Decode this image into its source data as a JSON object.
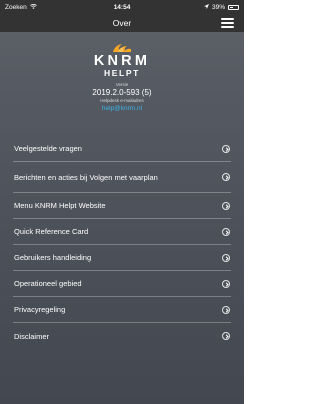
{
  "status_bar": {
    "carrier": "Zoeken",
    "time": "14:54",
    "battery": "39%"
  },
  "nav": {
    "title": "Over"
  },
  "logo": {
    "line1": "KNRM",
    "line2": "HELPT"
  },
  "version": {
    "label": "Versie",
    "value": "2019.2.0-593 (5)",
    "help_text": "Helpdesk e-mailadres",
    "email": "help@knrm.nl"
  },
  "menu_items": [
    {
      "label": "Veelgestelde vragen"
    },
    {
      "label": "Berichten en acties bij Volgen met vaarplan"
    },
    {
      "label": "Menu KNRM Helpt Website"
    },
    {
      "label": "Quick Reference Card"
    },
    {
      "label": "Gebruikers handleiding"
    },
    {
      "label": "Operationeel gebied"
    },
    {
      "label": "Privacyregeling"
    },
    {
      "label": "Disclaimer"
    }
  ],
  "icons": {
    "menu": "hamburger-menu-icon",
    "item_arrow": "chevron-right-circle-icon",
    "logo": "knrm-flame-logo"
  },
  "colors": {
    "bar_background": "#333333",
    "background": "#53575f",
    "link": "#3bb3e6",
    "logo_flame": "#f5a623"
  }
}
